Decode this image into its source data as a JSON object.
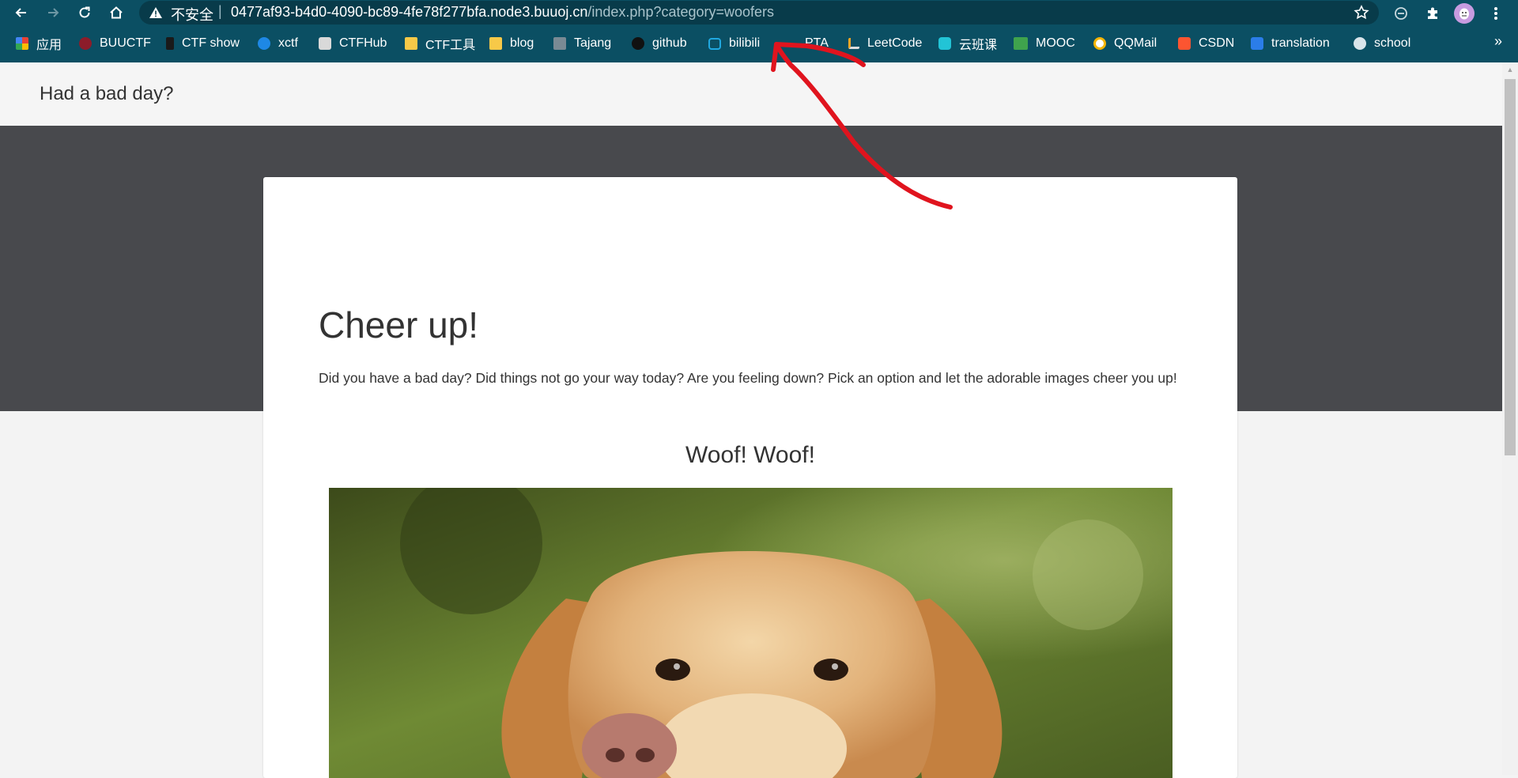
{
  "browser": {
    "security_label": "不安全",
    "separator": "|",
    "url_host": "0477af93-b4d0-4090-bc89-4fe78f277bfa.node3.buuoj.cn",
    "url_path": "/index.php?category=woofers",
    "toolbar_color": "#0b4f63"
  },
  "bookmarks": {
    "items": [
      {
        "label": "应用",
        "icon": "apps-grid-icon"
      },
      {
        "label": "BUUCTF",
        "icon": "buuctf-icon"
      },
      {
        "label": "CTF show",
        "icon": "ctfshow-icon"
      },
      {
        "label": "xctf",
        "icon": "xctf-icon"
      },
      {
        "label": "CTFHub",
        "icon": "ctfhub-icon"
      },
      {
        "label": "CTF工具",
        "icon": "folder-icon"
      },
      {
        "label": "blog",
        "icon": "folder-icon"
      },
      {
        "label": "Tajang",
        "icon": "tajang-icon"
      },
      {
        "label": "github",
        "icon": "github-icon"
      },
      {
        "label": "bilibili",
        "icon": "bilibili-icon"
      },
      {
        "label": "PTA",
        "icon": "pta-icon"
      },
      {
        "label": "LeetCode",
        "icon": "leetcode-icon"
      },
      {
        "label": "云班课",
        "icon": "cloud-class-icon"
      },
      {
        "label": "MOOC",
        "icon": "mooc-icon"
      },
      {
        "label": "QQMail",
        "icon": "qqmail-icon"
      },
      {
        "label": "CSDN",
        "icon": "csdn-icon"
      },
      {
        "label": "translation",
        "icon": "translate-icon"
      },
      {
        "label": "school",
        "icon": "globe-icon"
      }
    ],
    "more": "»"
  },
  "page": {
    "brand": "Had a bad day?",
    "heading": "Cheer up!",
    "lead": "Did you have a bad day? Did things not go your way today? Are you feeling down? Pick an option and let the adorable images cheer you up!",
    "subheading": "Woof! Woof!",
    "image_subject": "golden labrador dog"
  },
  "annotation": {
    "color": "#e0141e",
    "shape": "hand-drawn arrow pointing to the category parameter in the URL"
  }
}
